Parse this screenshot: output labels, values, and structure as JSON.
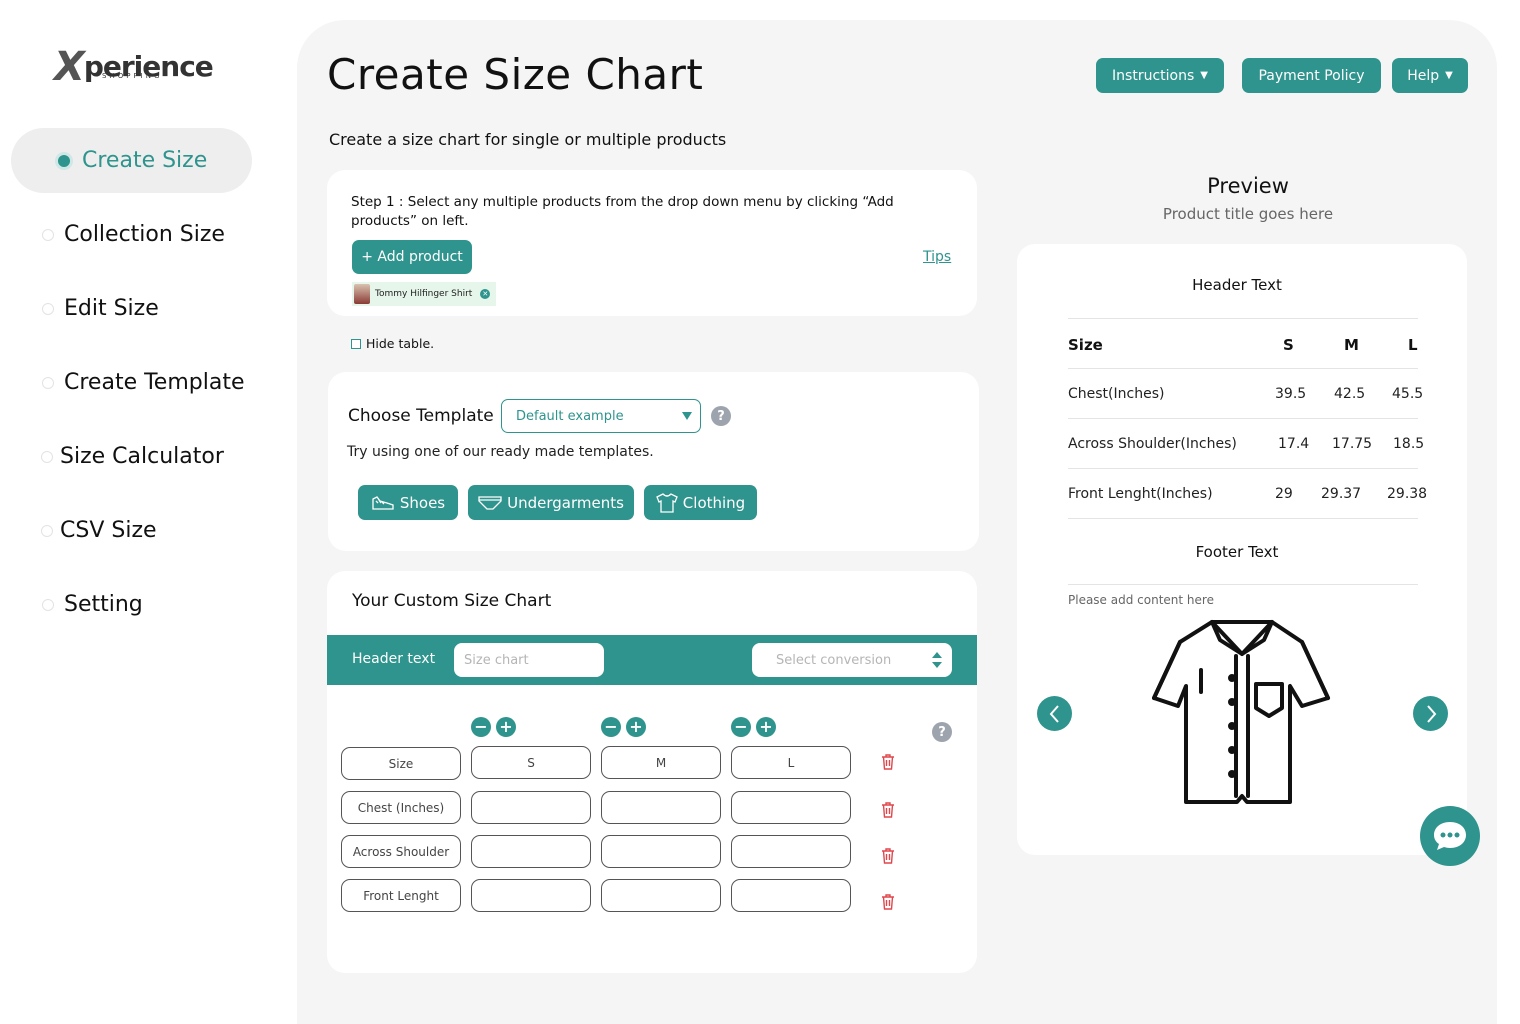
{
  "brand": {
    "name": "perience",
    "initial": "X",
    "tagline": "SHOPPING"
  },
  "sidebar": {
    "items": [
      {
        "label": "Create Size",
        "active": true
      },
      {
        "label": "Collection Size"
      },
      {
        "label": "Edit Size"
      },
      {
        "label": "Create Template"
      },
      {
        "label": "Size Calculator"
      },
      {
        "label": "CSV Size"
      },
      {
        "label": "Setting"
      }
    ]
  },
  "header": {
    "title": "Create Size Chart",
    "subtitle": "Create a size chart for single or multiple products",
    "buttons": {
      "instructions": "Instructions",
      "payment_policy": "Payment Policy",
      "help": "Help"
    }
  },
  "step1": {
    "text": "Step 1 : Select any multiple products from the drop down menu by clicking “Add products” on left.",
    "add_button": "+ Add product",
    "tips": "Tips",
    "chip": "Tommy Hilfinger Shirt"
  },
  "hide_table": {
    "label": "Hide table."
  },
  "template": {
    "label": "Choose Template",
    "selected": "Default example",
    "hint": "Try using one of our ready made templates.",
    "buttons": {
      "shoes": "Shoes",
      "undergarments": "Undergarments",
      "clothing": "Clothing"
    },
    "help": "?"
  },
  "custom": {
    "title": "Your Custom Size Chart",
    "header_label": "Header text",
    "header_placeholder": "Size chart",
    "conversion_placeholder": "Select conversion",
    "help": "?",
    "columns": [
      "S",
      "M",
      "L"
    ],
    "rows": [
      {
        "label": "Size",
        "values": [
          "S",
          "M",
          "L"
        ]
      },
      {
        "label": "Chest (Inches)",
        "values": [
          "",
          "",
          ""
        ]
      },
      {
        "label": "Across Shoulder",
        "values": [
          "",
          "",
          ""
        ]
      },
      {
        "label": "Front Lenght",
        "values": [
          "",
          "",
          ""
        ]
      }
    ]
  },
  "preview": {
    "title": "Preview",
    "product_title": "Product title goes here",
    "header_text": "Header Text",
    "footer_text": "Footer Text",
    "content_placeholder": "Please add content here",
    "table": {
      "head": [
        "Size",
        "S",
        "M",
        "L"
      ],
      "rows": [
        [
          "Chest(Inches)",
          "39.5",
          "42.5",
          "45.5"
        ],
        [
          "Across Shoulder(Inches)",
          "17.4",
          "17.75",
          "18.5"
        ],
        [
          "Front Lenght(Inches)",
          "29",
          "29.37",
          "29.38"
        ]
      ]
    }
  },
  "colors": {
    "accent": "#2e948d",
    "danger": "#e0474c",
    "panel": "#f5f5f5"
  }
}
